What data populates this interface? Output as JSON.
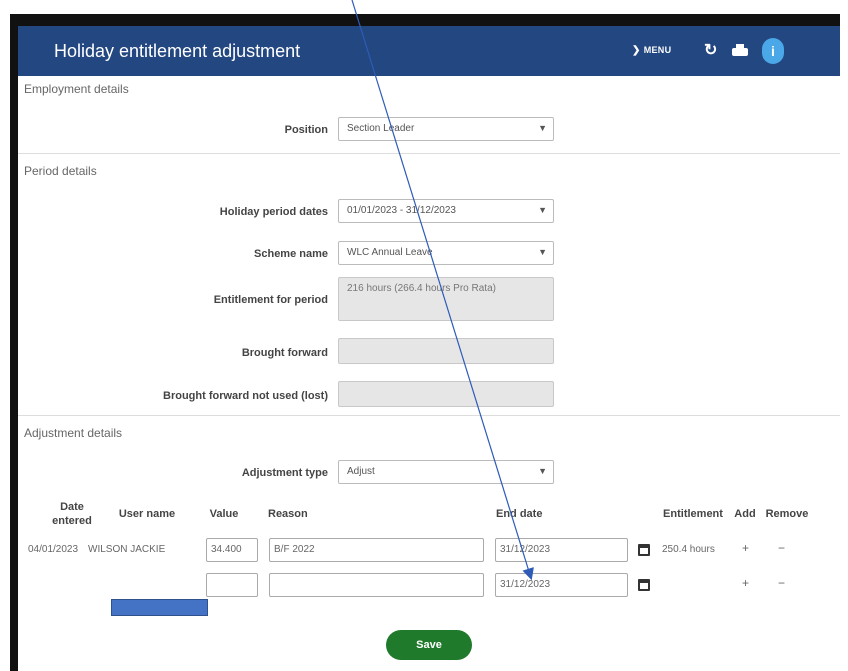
{
  "header": {
    "title": "Holiday entitlement adjustment",
    "menu_label": "MENU",
    "icons": [
      "chevron-down-icon",
      "refresh-icon",
      "print-icon",
      "info-icon"
    ],
    "bg_color": "#234780"
  },
  "employment": {
    "section_title": "Employment details",
    "position_label": "Position",
    "position_value": "Section Leader"
  },
  "period": {
    "section_title": "Period details",
    "holiday_dates_label": "Holiday period dates",
    "holiday_dates_value": "01/01/2023 - 31/12/2023",
    "scheme_label": "Scheme name",
    "scheme_value": "WLC Annual Leave",
    "entitlement_label": "Entitlement for period",
    "entitlement_value": "216 hours (266.4 hours Pro Rata)",
    "brought_forward_label": "Brought forward",
    "brought_forward_value": "",
    "bf_not_used_label": "Brought forward not used (lost)",
    "bf_not_used_value": ""
  },
  "adjustment": {
    "section_title": "Adjustment details",
    "type_label": "Adjustment type",
    "type_value": "Adjust",
    "columns": {
      "date_entered": "Date entered",
      "user_name": "User name",
      "value": "Value",
      "reason": "Reason",
      "end_date": "End date",
      "entitlement": "Entitlement",
      "add": "Add",
      "remove": "Remove"
    },
    "rows": [
      {
        "date_entered": "04/01/2023",
        "user_name": "WILSON JACKIE",
        "value": "34.400",
        "reason": "B/F 2022",
        "end_date": "31/12/2023",
        "entitlement": "250.4 hours",
        "add": "+",
        "remove": "−"
      },
      {
        "date_entered": "",
        "user_name": "",
        "value": "",
        "reason": "",
        "end_date": "31/12/2023",
        "entitlement": "",
        "add": "+",
        "remove": "−"
      }
    ]
  },
  "save_label": "Save",
  "colors": {
    "save": "#1f7a2b",
    "annotation": "#4472c4"
  }
}
